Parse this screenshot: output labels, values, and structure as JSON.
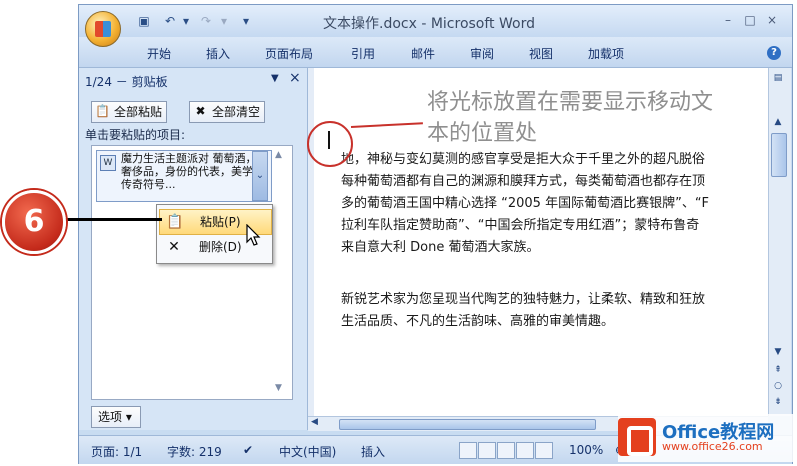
{
  "window": {
    "title": "文本操作.docx - Microsoft Word",
    "controls": {
      "minimize": "–",
      "maximize": "□",
      "close": "×"
    }
  },
  "quick_access": {
    "dropdown": "▾"
  },
  "ribbon_tabs": [
    "开始",
    "插入",
    "页面布局",
    "引用",
    "邮件",
    "审阅",
    "视图",
    "加载项"
  ],
  "clipboard": {
    "header": "1/24 － 剪贴板",
    "paste_all": "全部粘贴",
    "clear_all": "全部清空",
    "hint": "单击要粘贴的项目:",
    "item_text": "魔力生活主题派对 葡萄酒，奢侈品，身份的代表，美学和传奇符号...",
    "options": "选项 ▾"
  },
  "context_menu": {
    "items": [
      {
        "label": "粘贴(P)"
      },
      {
        "label": "删除(D)"
      }
    ]
  },
  "callout": {
    "text": "将光标放置在需要显示移动文本的位置处"
  },
  "document": {
    "lines": [
      "地，神秘与变幻莫测的感官享受是拒大众于千里之外的超凡脱俗",
      "每种葡萄酒都有自己的渊源和膜拜方式，每类葡萄酒也都存在顶",
      "多的葡萄酒王国中精心选择 “2005 年国际葡萄酒比赛银牌”、“F",
      "拉利车队指定赞助商”、“中国会所指定专用红酒”；蒙特布鲁奇",
      "来自意大利 Done 葡萄酒大家族。",
      "",
      "新锐艺术家为您呈现当代陶艺的独特魅力，让柔软、精致和狂放",
      "生活品质、不凡的生活韵味、高雅的审美情趣。"
    ]
  },
  "status_bar": {
    "page": "页面: 1/1",
    "words": "字数: 219",
    "language": "中文(中国)",
    "mode": "插入",
    "zoom": "100%"
  },
  "step_badge": "6",
  "watermark": {
    "line1": "Office教程网",
    "line2": "www.office26.com"
  },
  "colors": {
    "accent_red": "#c8312b",
    "ribbon_blue": "#c2d6ef"
  }
}
